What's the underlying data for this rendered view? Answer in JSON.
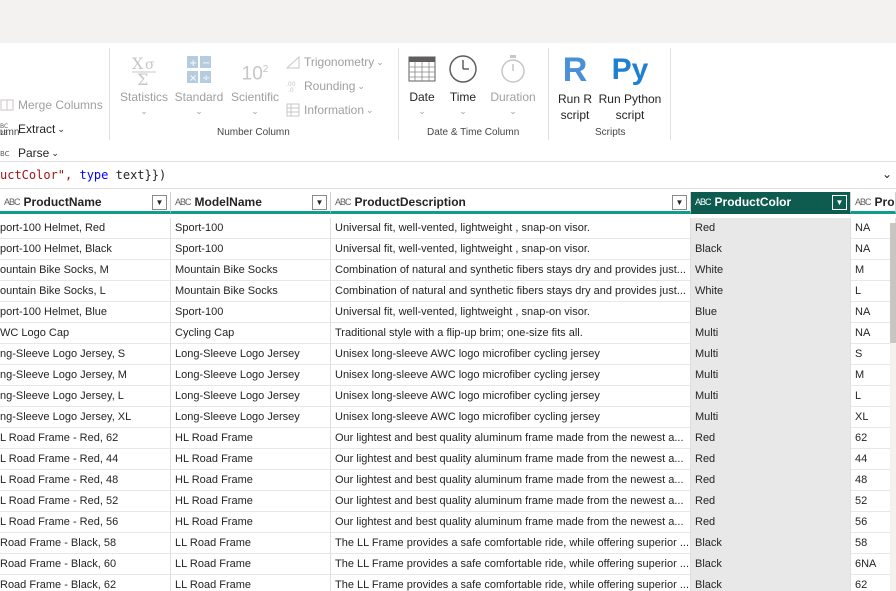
{
  "ribbon": {
    "text_group": {
      "label": "umn",
      "merge_columns": "Merge Columns",
      "extract": "Extract",
      "parse": "Parse"
    },
    "number_group": {
      "label": "Number Column",
      "statistics": "Statistics",
      "standard": "Standard",
      "scientific": "Scientific",
      "scientific_glyph": "10",
      "scientific_sup": "2",
      "trigonometry": "Trigonometry",
      "rounding": "Rounding",
      "information": "Information"
    },
    "datetime_group": {
      "label": "Date & Time Column",
      "date": "Date",
      "time": "Time",
      "duration": "Duration"
    },
    "scripts_group": {
      "label": "Scripts",
      "run_r_line1": "Run R",
      "run_r_line2": "script",
      "run_py_line1": "Run Python",
      "run_py_line2": "script",
      "r_glyph": "R",
      "py_glyph": "Py"
    }
  },
  "formula": {
    "part1": "uctColor\", ",
    "keyword": "type",
    "part2": " text}})"
  },
  "columns": [
    {
      "type_icon": "ABC",
      "name": "ProductName"
    },
    {
      "type_icon": "ABC",
      "name": "ModelName"
    },
    {
      "type_icon": "ABC",
      "name": "ProductDescription"
    },
    {
      "type_icon": "ABC",
      "name": "ProductColor",
      "selected": true
    },
    {
      "type_icon": "ABC",
      "name": "Pro"
    }
  ],
  "rows": [
    [
      "port-100 Helmet, Red",
      "Sport-100",
      "Universal fit, well-vented, lightweight , snap-on visor.",
      "Red",
      "NA"
    ],
    [
      "port-100 Helmet, Black",
      "Sport-100",
      "Universal fit, well-vented, lightweight , snap-on visor.",
      "Black",
      "NA"
    ],
    [
      "ountain Bike Socks, M",
      "Mountain Bike Socks",
      "Combination of natural and synthetic fibers stays dry and provides just...",
      "White",
      "M"
    ],
    [
      "ountain Bike Socks, L",
      "Mountain Bike Socks",
      "Combination of natural and synthetic fibers stays dry and provides just...",
      "White",
      "L"
    ],
    [
      "port-100 Helmet, Blue",
      "Sport-100",
      "Universal fit, well-vented, lightweight , snap-on visor.",
      "Blue",
      "NA"
    ],
    [
      "WC Logo Cap",
      "Cycling Cap",
      "Traditional style with a flip-up brim; one-size fits all.",
      "Multi",
      "NA"
    ],
    [
      "ng-Sleeve Logo Jersey, S",
      "Long-Sleeve Logo Jersey",
      "Unisex long-sleeve AWC logo microfiber cycling jersey",
      "Multi",
      "S"
    ],
    [
      "ng-Sleeve Logo Jersey, M",
      "Long-Sleeve Logo Jersey",
      "Unisex long-sleeve AWC logo microfiber cycling jersey",
      "Multi",
      "M"
    ],
    [
      "ng-Sleeve Logo Jersey, L",
      "Long-Sleeve Logo Jersey",
      "Unisex long-sleeve AWC logo microfiber cycling jersey",
      "Multi",
      "L"
    ],
    [
      "ng-Sleeve Logo Jersey, XL",
      "Long-Sleeve Logo Jersey",
      "Unisex long-sleeve AWC logo microfiber cycling jersey",
      "Multi",
      "XL"
    ],
    [
      "L Road Frame - Red, 62",
      "HL Road Frame",
      "Our lightest and best quality aluminum frame made from the newest a...",
      "Red",
      "62"
    ],
    [
      "L Road Frame - Red, 44",
      "HL Road Frame",
      "Our lightest and best quality aluminum frame made from the newest a...",
      "Red",
      "44"
    ],
    [
      "L Road Frame - Red, 48",
      "HL Road Frame",
      "Our lightest and best quality aluminum frame made from the newest a...",
      "Red",
      "48"
    ],
    [
      "L Road Frame - Red, 52",
      "HL Road Frame",
      "Our lightest and best quality aluminum frame made from the newest a...",
      "Red",
      "52"
    ],
    [
      "L Road Frame - Red, 56",
      "HL Road Frame",
      "Our lightest and best quality aluminum frame made from the newest a...",
      "Red",
      "56"
    ],
    [
      " Road Frame - Black, 58",
      "LL Road Frame",
      "The LL Frame provides a safe comfortable ride, while offering superior ...",
      "Black",
      "58"
    ],
    [
      " Road Frame - Black, 60",
      "LL Road Frame",
      "The LL Frame provides a safe comfortable ride, while offering superior ...",
      "Black",
      "6NA"
    ],
    [
      " Road Frame - Black, 62",
      "LL Road Frame",
      "The LL Frame provides a safe comfortable ride, while offering superior ...",
      "Black",
      "62"
    ]
  ],
  "colors": {
    "accent_teal": "#0f9d8b",
    "selected_header": "#0e5c4f",
    "r_icon": "#4a90d9",
    "py_icon": "#1f7fd1"
  }
}
